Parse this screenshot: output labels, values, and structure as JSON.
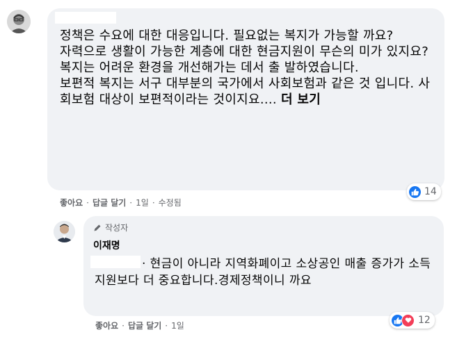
{
  "comment": {
    "author_hidden": true,
    "lines": [
      "정책은 수요에 대한 대응입니다. 필요없는 복지가 가능할 까요?",
      "자력으로 생활이 가능한 계층에 대한 현금지원이 무슨의 미가 있지요? 복지는 어려운 환경을 개선해가는 데서 출 발하였습니다.",
      "보편적 복지는 서구 대부분의 국가에서 사회보험과 같은 것 입니다. 사회보험 대상이 보편적이라는 것이지요.... "
    ],
    "see_more": "더 보기",
    "actions": {
      "like": "좋아요",
      "reply": "답글 달기",
      "time": "1일",
      "edited": "수정됨"
    },
    "reactions_count": "14"
  },
  "reply": {
    "badge": "작성자",
    "author": "이재명",
    "text": "· 현금이 아니라 지역화폐이고 소상공인 매출 증가가 소득지원보다 더 중요합니다.경제정책이니 까요",
    "actions": {
      "like": "좋아요",
      "reply": "답글 달기",
      "time": "1일"
    },
    "reactions_count": "12"
  },
  "colors": {
    "bubble": "#f0f2f5",
    "like": "#1877f2",
    "love": "#f33e58",
    "meta": "#65676b"
  }
}
